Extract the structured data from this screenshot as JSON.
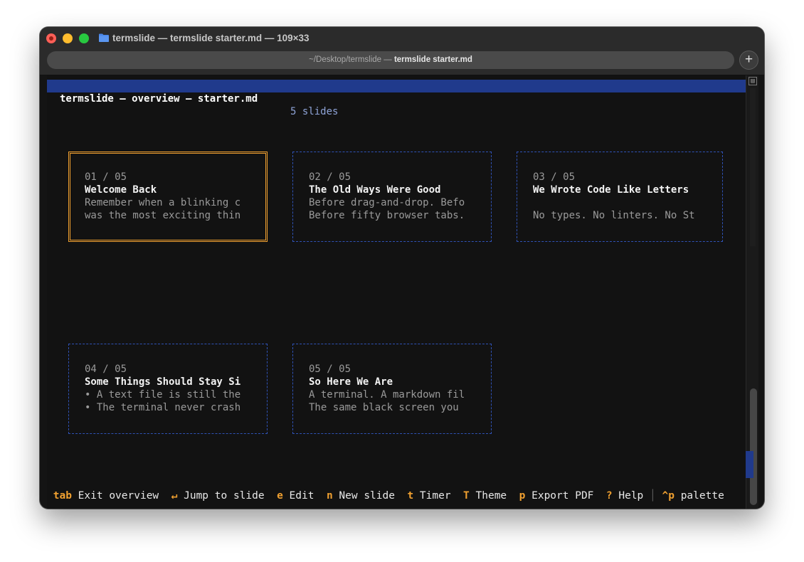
{
  "window": {
    "title": "termslide — termslide starter.md — 109×33",
    "path_prefix": "~/Desktop/termslide — ",
    "path_doc": "termslide starter.md",
    "new_tab_label": "+"
  },
  "header": {
    "title": "termslide — overview — starter.md",
    "count": "5 slides"
  },
  "slides": [
    {
      "num": "01 / 05",
      "title": "Welcome Back",
      "line1": "Remember when a blinking c",
      "line2": "was the most exciting thin"
    },
    {
      "num": "02 / 05",
      "title": "The Old Ways Were Good",
      "line1": "Before drag-and-drop. Befo",
      "line2": "Before fifty browser tabs."
    },
    {
      "num": "03 / 05",
      "title": "We Wrote Code Like Letters",
      "line1": "",
      "line2": "No types. No linters. No St"
    },
    {
      "num": "04 / 05",
      "title": "Some Things Should Stay Si",
      "line1": "• A text file is still the",
      "line2": "• The terminal never crash"
    },
    {
      "num": "05 / 05",
      "title": "So Here We Are",
      "line1": "A terminal. A markdown fil",
      "line2": "The same black screen you"
    }
  ],
  "statusbar": {
    "tab_key": "tab",
    "tab_label": "Exit overview",
    "enter_key": "↵",
    "enter_label": "Jump to slide",
    "edit_key": "e",
    "edit_label": "Edit",
    "new_key": "n",
    "new_label": "New slide",
    "timer_key": "t",
    "timer_label": "Timer",
    "theme_key": "T",
    "theme_label": "Theme",
    "export_key": "p",
    "export_label": "Export PDF",
    "help_key": "?",
    "help_label": "Help",
    "palette_key": "^p",
    "palette_label": "palette"
  },
  "colors": {
    "accent_orange": "#f0a030",
    "header_blue": "#203a8c",
    "card_border_blue": "#2f52b6",
    "terminal_bg": "#121212"
  },
  "icons": {
    "folder": "folder-icon",
    "scroll_top": "scroll-to-top-icon"
  }
}
